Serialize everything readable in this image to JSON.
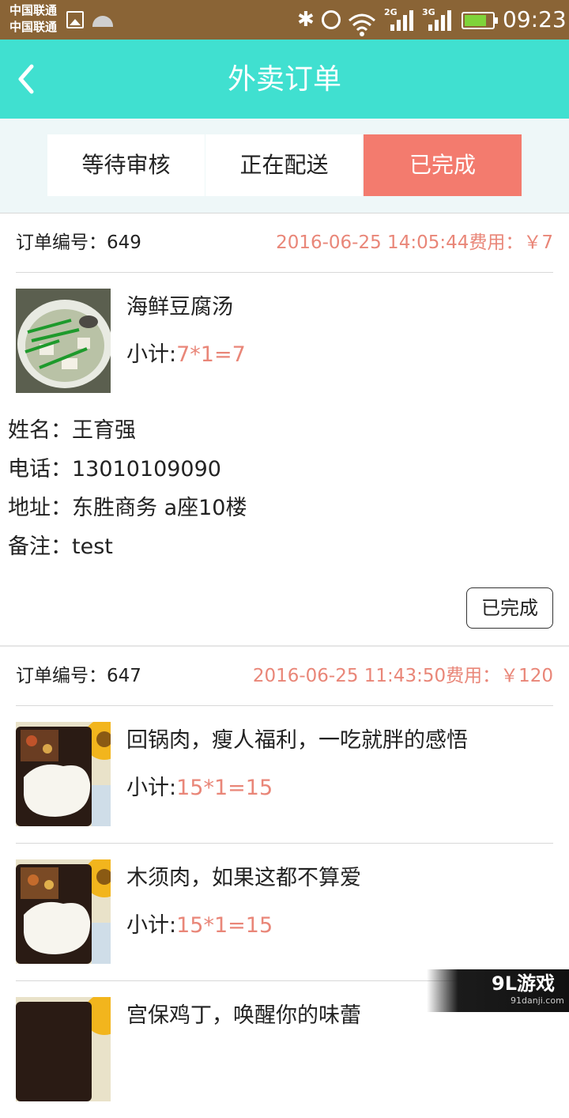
{
  "status_bar": {
    "carrier_1": "中国联通",
    "carrier_2": "中国联通",
    "network_1": "2G",
    "network_2": "3G",
    "time": "09:23",
    "colors": {
      "background": "#8a6436",
      "battery": "#7fd33a"
    },
    "battery_level": 0.8
  },
  "header": {
    "title": "外卖订单",
    "back_icon": "chevron-left-icon",
    "color": "#40e0d0"
  },
  "tabs": [
    {
      "label": "等待审核",
      "selected": false
    },
    {
      "label": "正在配送",
      "selected": false
    },
    {
      "label": "已完成",
      "selected": true
    }
  ],
  "accent_color": "#f37b6e",
  "orders": [
    {
      "order_label": "订单编号：",
      "order_no": "649",
      "meta": "2016-06-25 14:05:44费用：￥7",
      "items": [
        {
          "name": "海鲜豆腐汤",
          "subtotal_label": "小计:",
          "subtotal": "7*1=7"
        }
      ],
      "customer": {
        "name_label": "姓名：",
        "name": "王育强",
        "phone_label": "电话：",
        "phone": "13010109090",
        "address_label": "地址：",
        "address": "东胜商务 a座10楼",
        "note_label": "备注：",
        "note": "test"
      },
      "status_button": "已完成"
    },
    {
      "order_label": "订单编号：",
      "order_no": "647",
      "meta": "2016-06-25 11:43:50费用：￥120",
      "items": [
        {
          "name": "回锅肉，瘦人福利，一吃就胖的感悟",
          "subtotal_label": "小计:",
          "subtotal": "15*1=15"
        },
        {
          "name": "木须肉，如果这都不算爱",
          "subtotal_label": "小计:",
          "subtotal": "15*1=15"
        },
        {
          "name": "宫保鸡丁，唤醒你的味蕾"
        }
      ]
    }
  ],
  "watermark": {
    "logo": "9L游戏",
    "url": "91danji.com"
  }
}
